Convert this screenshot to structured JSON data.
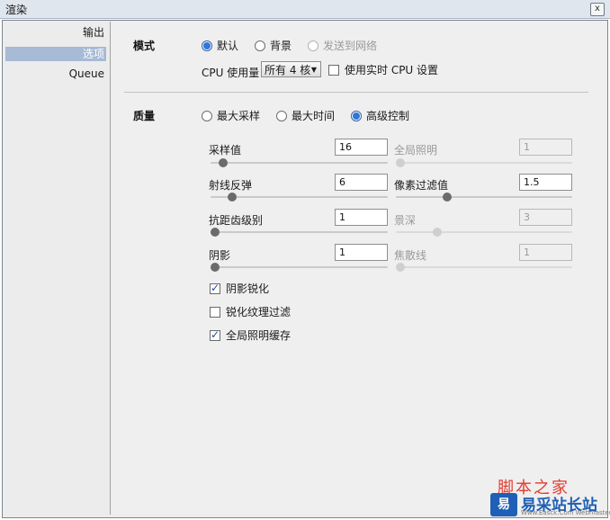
{
  "window": {
    "title": "渲染",
    "close_glyph": "x"
  },
  "sidebar": {
    "items": [
      "输出",
      "选项",
      "Queue"
    ],
    "active_index": 1
  },
  "mode": {
    "label": "模式",
    "options": [
      {
        "label": "默认",
        "checked": true,
        "disabled": false
      },
      {
        "label": "背景",
        "checked": false,
        "disabled": false
      },
      {
        "label": "发送到网络",
        "checked": false,
        "disabled": true
      }
    ],
    "cpu_label": "CPU 使用量",
    "cpu_value": "所有 4 核",
    "realtime_cpu_label": "使用实时 CPU 设置",
    "realtime_cpu_checked": false
  },
  "quality": {
    "label": "质量",
    "options": [
      {
        "label": "最大采样",
        "checked": false
      },
      {
        "label": "最大时间",
        "checked": false
      },
      {
        "label": "高级控制",
        "checked": true
      }
    ],
    "params": {
      "sampling": {
        "label": "采样值",
        "value": "16",
        "level": 0.05,
        "disabled": false
      },
      "global_illum": {
        "label": "全局照明",
        "value": "1",
        "level": 0.0,
        "disabled": true
      },
      "ray_bounce": {
        "label": "射线反弹",
        "value": "6",
        "level": 0.1,
        "disabled": false
      },
      "pixel_filter": {
        "label": "像素过滤值",
        "value": "1.5",
        "level": 0.28,
        "disabled": false
      },
      "antialias": {
        "label": "抗距齿级别",
        "value": "1",
        "level": 0.0,
        "disabled": false
      },
      "dof": {
        "label": "景深",
        "value": "3",
        "level": 0.22,
        "disabled": true
      },
      "shadow": {
        "label": "阴影",
        "value": "1",
        "level": 0.0,
        "disabled": false
      },
      "caustics": {
        "label": "焦散线",
        "value": "1",
        "level": 0.0,
        "disabled": true
      }
    },
    "checkboxes": [
      {
        "label": "阴影锐化",
        "checked": true
      },
      {
        "label": "锐化纹理过滤",
        "checked": false
      },
      {
        "label": "全局照明缓存",
        "checked": true
      }
    ]
  },
  "watermark": {
    "script": "脚本之家",
    "logo": "易",
    "name": "易采站长站",
    "url": "Www.Easck.Com Webmaster"
  }
}
